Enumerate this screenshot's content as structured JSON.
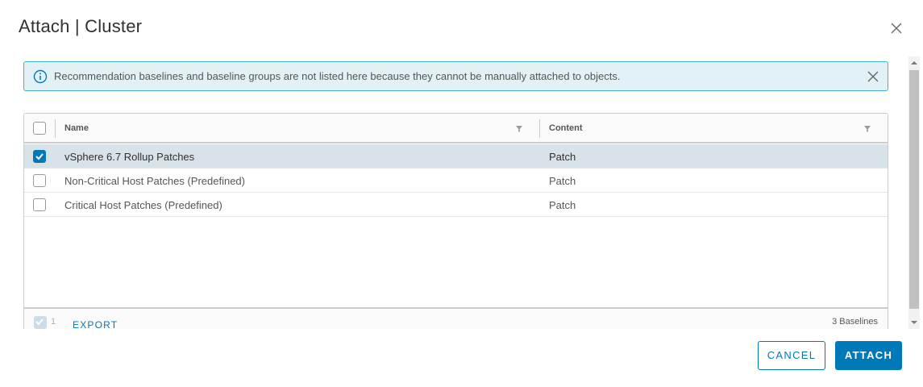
{
  "dialog": {
    "title": "Attach | Cluster"
  },
  "alert": {
    "message": "Recommendation baselines and baseline groups are not listed here because they cannot be manually attached to objects."
  },
  "grid": {
    "columns": [
      {
        "label": "Name"
      },
      {
        "label": "Content"
      }
    ],
    "rows": [
      {
        "name": "vSphere 6.7 Rollup Patches",
        "content": "Patch",
        "selected": true
      },
      {
        "name": "Non-Critical Host Patches (Predefined)",
        "content": "Patch",
        "selected": false
      },
      {
        "name": "Critical Host Patches (Predefined)",
        "content": "Patch",
        "selected": false
      }
    ],
    "footer": {
      "selected_count": "1",
      "export_label": "EXPORT",
      "total_label": "3 Baselines"
    }
  },
  "actions": {
    "cancel_label": "CANCEL",
    "attach_label": "ATTACH"
  },
  "colors": {
    "accent": "#0079b8",
    "alert_bg": "#e1f1f6",
    "selected_row": "#d8e3e9"
  },
  "icons": {
    "close": "close-icon",
    "info": "info-icon",
    "filter": "filter-icon",
    "check": "check-icon"
  }
}
